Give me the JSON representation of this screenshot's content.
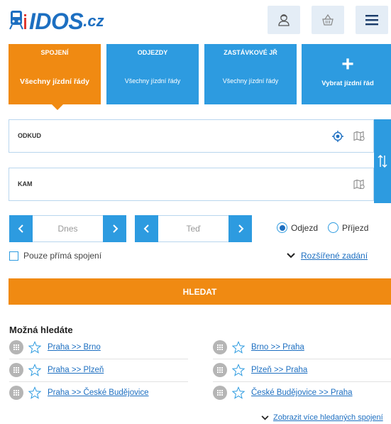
{
  "header": {
    "logo_text": "IDOS",
    "logo_domain": ".cz",
    "icons": [
      "user-icon",
      "basket-icon",
      "menu-icon"
    ]
  },
  "tabs": [
    {
      "title": "SPOJENÍ",
      "subtitle": "Všechny jízdní řády",
      "active": true
    },
    {
      "title": "ODJEZDY",
      "subtitle": "Všechny jízdní řády",
      "active": false
    },
    {
      "title": "ZASTÁVKOVÉ JŘ",
      "subtitle": "Všechny jízdní řády",
      "active": false
    },
    {
      "title": "+",
      "subtitle": "Vybrat jízdní řád",
      "active": false
    }
  ],
  "form": {
    "from_label": "ODKUD",
    "to_label": "KAM",
    "date_value": "Dnes",
    "time_value": "Teď",
    "radio_departure": "Odjezd",
    "radio_arrival": "Příjezd",
    "selected_radio": "Odjezd",
    "direct_only": "Pouze přímá spojení",
    "advanced": "Rozšířené zadání",
    "search_button": "HLEDAT"
  },
  "suggestions": {
    "title": "Možná hledáte",
    "items": [
      "Praha >> Brno",
      "Brno >> Praha",
      "Praha >> Plzeň",
      "Plzeň >> Praha",
      "Praha >> České Budějovice",
      "České Budějovice >> Praha"
    ],
    "more": "Zobrazit více hledaných spojení"
  },
  "colors": {
    "accent_orange": "#f08a12",
    "accent_blue": "#2d9be0",
    "link_blue": "#1d6fc1"
  }
}
